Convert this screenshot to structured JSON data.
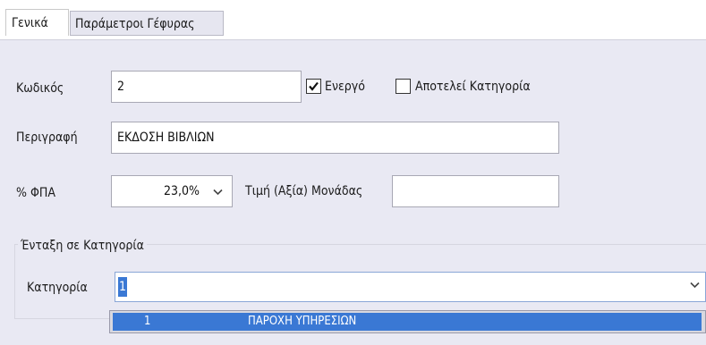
{
  "tabs": [
    {
      "label": "Γενικά",
      "active": true
    },
    {
      "label": "Παράμετροι Γέφυρας",
      "active": false
    }
  ],
  "form": {
    "code_label": "Κωδικός",
    "code_value": "2",
    "active_label": "Ενεργό",
    "active_checked": true,
    "category_flag_label": "Αποτελεί Κατηγορία",
    "category_flag_checked": false,
    "description_label": "Περιγραφή",
    "description_value": "ΕΚΔΟΣΗ ΒΙΒΛΙΩΝ",
    "vat_label": "% ΦΠΑ",
    "vat_value": "23,0%",
    "unit_price_label": "Τιμή (Αξία) Μονάδας",
    "unit_price_value": ""
  },
  "category_group": {
    "title": "Ένταξη σε Κατηγορία",
    "category_label": "Κατηγορία",
    "category_value": "1",
    "options": [
      {
        "code": "1",
        "name": "ΠΑΡΟΧΗ ΥΠΗΡΕΣΙΩΝ"
      }
    ]
  },
  "colors": {
    "panel_bg": "#e9e9f3",
    "selection": "#3a78d4"
  }
}
